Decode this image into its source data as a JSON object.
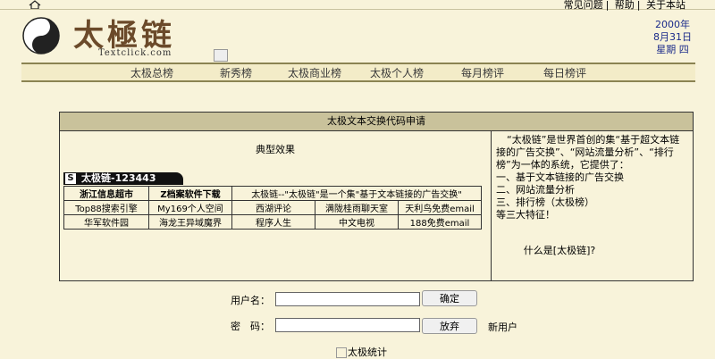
{
  "top_links": [
    "常见问题",
    "帮助",
    "关于本站"
  ],
  "logo": {
    "name": "太極链",
    "sub": "Textclick.com"
  },
  "date": {
    "year": "2000年",
    "day": "8月31日",
    "weekday": "星期 四"
  },
  "nav": [
    "太极总榜",
    "新秀榜",
    "太极商业榜",
    "太极个人榜",
    "每月榜评",
    "每日榜评"
  ],
  "panel": {
    "title": "太极文本交换代码申请",
    "effect_title": "典型效果",
    "tab_label": "太极链-123443",
    "table": [
      [
        "浙江信息超市",
        "Z档案软件下载",
        "太极链--\"太极链\"是一个集\"基于文本链接的广告交换\""
      ],
      [
        "Top88搜索引擎",
        "My169个人空间",
        "西湖评论",
        "满陇桂雨聊天室",
        "天利鸟免费email"
      ],
      [
        "华军软件园",
        "海龙王异域魔界",
        "程序人生",
        "中文电视",
        "188免费email"
      ]
    ],
    "desc": [
      "“太极链”是世界首创的集“基于超文本链接的广告交换”、“网站流量分析”、“排行榜”为一体的系统，它提供了：",
      "一、基于文本链接的广告交换",
      "二、网站流量分析",
      "三、排行榜（太极榜）",
      "等三大特征！"
    ],
    "what_link": "什么是[太极链]?"
  },
  "form": {
    "username_label": "用户名：",
    "password_label": "密　码：",
    "ok_button": "确定",
    "cancel_button": "放弃",
    "new_user": "新用户"
  },
  "footer": {
    "stat_alt": "太极统计"
  },
  "colors": {
    "background": "#f8f3da",
    "header_bar": "#c9c29b",
    "nav_line": "#8b8352",
    "date_text": "#1a2a8a"
  }
}
